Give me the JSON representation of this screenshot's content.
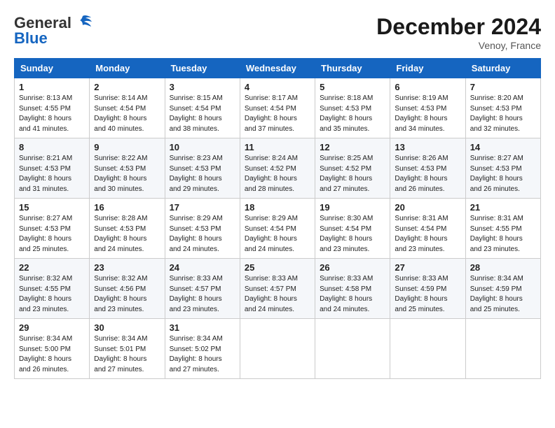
{
  "header": {
    "logo_general": "General",
    "logo_blue": "Blue",
    "month_title": "December 2024",
    "location": "Venoy, France"
  },
  "days_of_week": [
    "Sunday",
    "Monday",
    "Tuesday",
    "Wednesday",
    "Thursday",
    "Friday",
    "Saturday"
  ],
  "weeks": [
    [
      {
        "day": "1",
        "sunrise": "8:13 AM",
        "sunset": "4:55 PM",
        "daylight": "8 hours and 41 minutes."
      },
      {
        "day": "2",
        "sunrise": "8:14 AM",
        "sunset": "4:54 PM",
        "daylight": "8 hours and 40 minutes."
      },
      {
        "day": "3",
        "sunrise": "8:15 AM",
        "sunset": "4:54 PM",
        "daylight": "8 hours and 38 minutes."
      },
      {
        "day": "4",
        "sunrise": "8:17 AM",
        "sunset": "4:54 PM",
        "daylight": "8 hours and 37 minutes."
      },
      {
        "day": "5",
        "sunrise": "8:18 AM",
        "sunset": "4:53 PM",
        "daylight": "8 hours and 35 minutes."
      },
      {
        "day": "6",
        "sunrise": "8:19 AM",
        "sunset": "4:53 PM",
        "daylight": "8 hours and 34 minutes."
      },
      {
        "day": "7",
        "sunrise": "8:20 AM",
        "sunset": "4:53 PM",
        "daylight": "8 hours and 32 minutes."
      }
    ],
    [
      {
        "day": "8",
        "sunrise": "8:21 AM",
        "sunset": "4:53 PM",
        "daylight": "8 hours and 31 minutes."
      },
      {
        "day": "9",
        "sunrise": "8:22 AM",
        "sunset": "4:53 PM",
        "daylight": "8 hours and 30 minutes."
      },
      {
        "day": "10",
        "sunrise": "8:23 AM",
        "sunset": "4:53 PM",
        "daylight": "8 hours and 29 minutes."
      },
      {
        "day": "11",
        "sunrise": "8:24 AM",
        "sunset": "4:52 PM",
        "daylight": "8 hours and 28 minutes."
      },
      {
        "day": "12",
        "sunrise": "8:25 AM",
        "sunset": "4:52 PM",
        "daylight": "8 hours and 27 minutes."
      },
      {
        "day": "13",
        "sunrise": "8:26 AM",
        "sunset": "4:53 PM",
        "daylight": "8 hours and 26 minutes."
      },
      {
        "day": "14",
        "sunrise": "8:27 AM",
        "sunset": "4:53 PM",
        "daylight": "8 hours and 26 minutes."
      }
    ],
    [
      {
        "day": "15",
        "sunrise": "8:27 AM",
        "sunset": "4:53 PM",
        "daylight": "8 hours and 25 minutes."
      },
      {
        "day": "16",
        "sunrise": "8:28 AM",
        "sunset": "4:53 PM",
        "daylight": "8 hours and 24 minutes."
      },
      {
        "day": "17",
        "sunrise": "8:29 AM",
        "sunset": "4:53 PM",
        "daylight": "8 hours and 24 minutes."
      },
      {
        "day": "18",
        "sunrise": "8:29 AM",
        "sunset": "4:54 PM",
        "daylight": "8 hours and 24 minutes."
      },
      {
        "day": "19",
        "sunrise": "8:30 AM",
        "sunset": "4:54 PM",
        "daylight": "8 hours and 23 minutes."
      },
      {
        "day": "20",
        "sunrise": "8:31 AM",
        "sunset": "4:54 PM",
        "daylight": "8 hours and 23 minutes."
      },
      {
        "day": "21",
        "sunrise": "8:31 AM",
        "sunset": "4:55 PM",
        "daylight": "8 hours and 23 minutes."
      }
    ],
    [
      {
        "day": "22",
        "sunrise": "8:32 AM",
        "sunset": "4:55 PM",
        "daylight": "8 hours and 23 minutes."
      },
      {
        "day": "23",
        "sunrise": "8:32 AM",
        "sunset": "4:56 PM",
        "daylight": "8 hours and 23 minutes."
      },
      {
        "day": "24",
        "sunrise": "8:33 AM",
        "sunset": "4:57 PM",
        "daylight": "8 hours and 23 minutes."
      },
      {
        "day": "25",
        "sunrise": "8:33 AM",
        "sunset": "4:57 PM",
        "daylight": "8 hours and 24 minutes."
      },
      {
        "day": "26",
        "sunrise": "8:33 AM",
        "sunset": "4:58 PM",
        "daylight": "8 hours and 24 minutes."
      },
      {
        "day": "27",
        "sunrise": "8:33 AM",
        "sunset": "4:59 PM",
        "daylight": "8 hours and 25 minutes."
      },
      {
        "day": "28",
        "sunrise": "8:34 AM",
        "sunset": "4:59 PM",
        "daylight": "8 hours and 25 minutes."
      }
    ],
    [
      {
        "day": "29",
        "sunrise": "8:34 AM",
        "sunset": "5:00 PM",
        "daylight": "8 hours and 26 minutes."
      },
      {
        "day": "30",
        "sunrise": "8:34 AM",
        "sunset": "5:01 PM",
        "daylight": "8 hours and 27 minutes."
      },
      {
        "day": "31",
        "sunrise": "8:34 AM",
        "sunset": "5:02 PM",
        "daylight": "8 hours and 27 minutes."
      },
      null,
      null,
      null,
      null
    ]
  ]
}
